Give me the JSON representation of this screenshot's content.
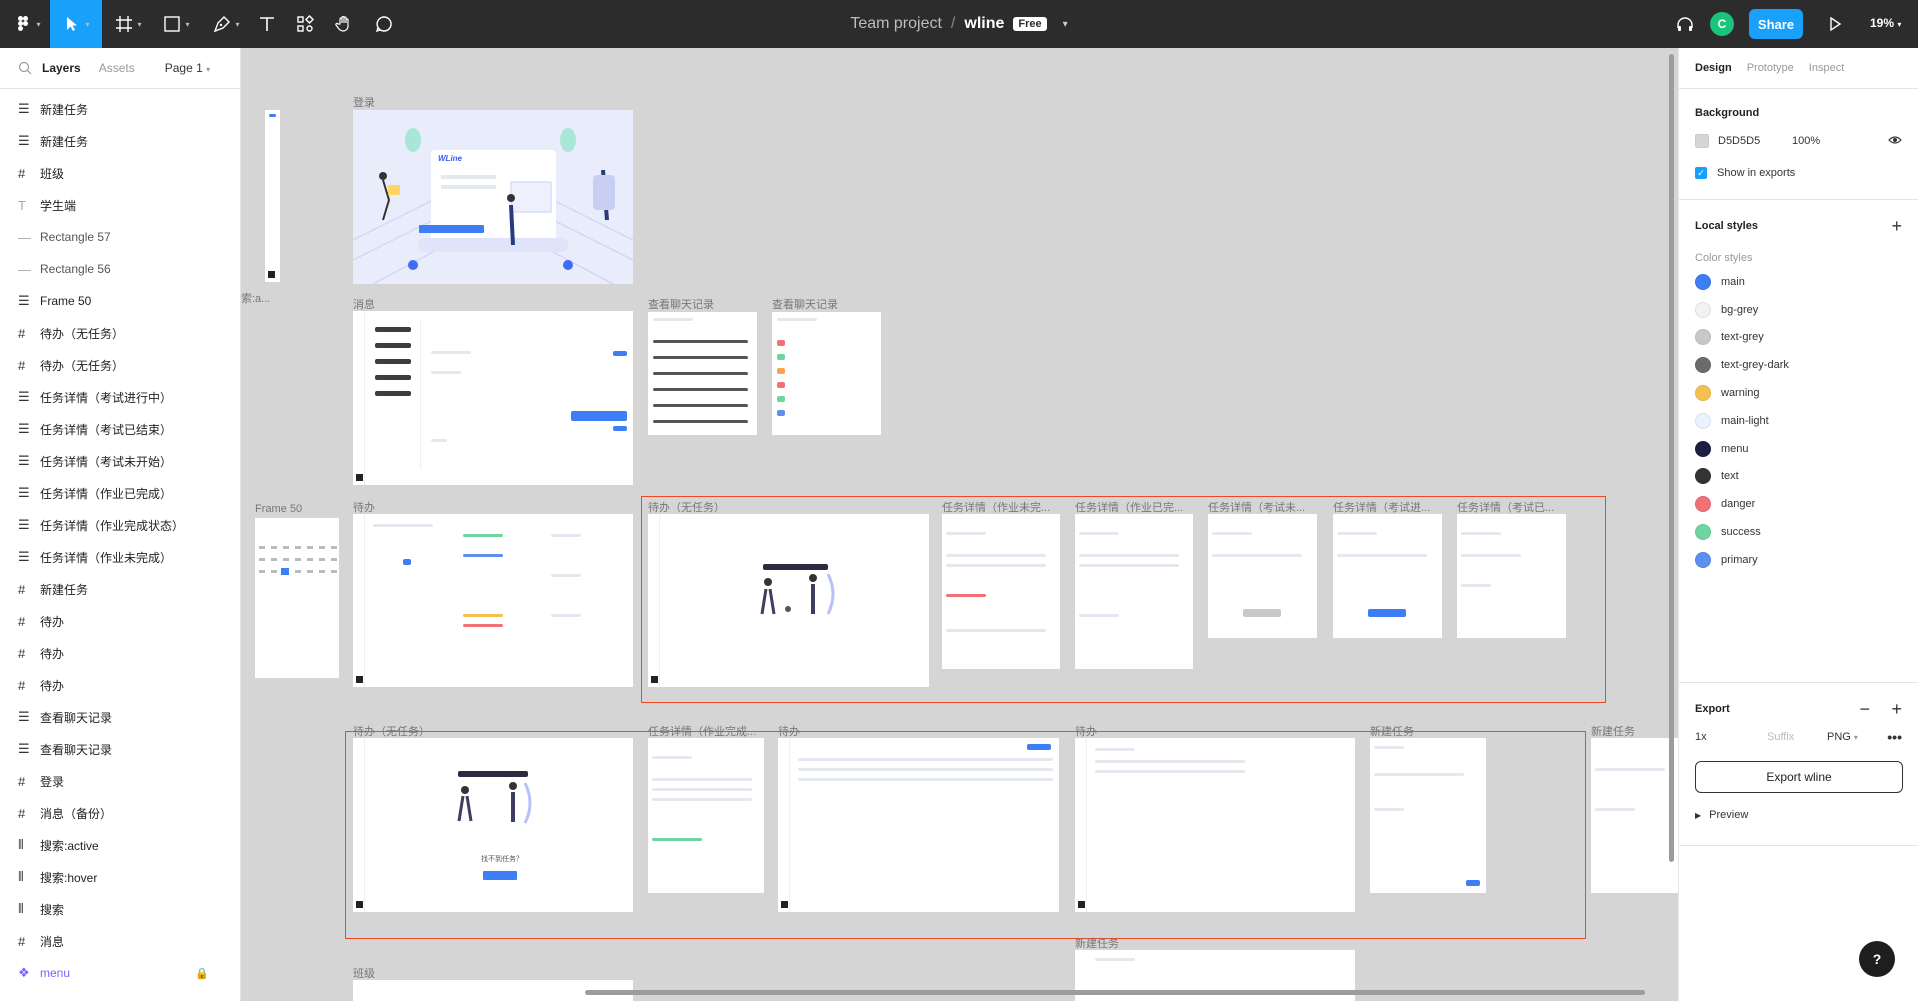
{
  "toolbar": {
    "project": "Team project",
    "separator": "/",
    "file": "wline",
    "plan_badge": "Free",
    "share_label": "Share",
    "avatar_initial": "C",
    "zoom": "19%"
  },
  "left_panel": {
    "tabs": [
      "Layers",
      "Assets"
    ],
    "page": "Page 1",
    "layers": [
      {
        "label": "新建任务",
        "icon": "rows-icon"
      },
      {
        "label": "新建任务",
        "icon": "rows-icon"
      },
      {
        "label": "班级",
        "icon": "frame-icon"
      },
      {
        "label": "学生端",
        "icon": "text-icon"
      },
      {
        "label": "Rectangle 57",
        "icon": "rectangle-icon"
      },
      {
        "label": "Rectangle 56",
        "icon": "rectangle-icon"
      },
      {
        "label": "Frame 50",
        "icon": "rows-icon"
      },
      {
        "label": "待办（无任务）",
        "icon": "frame-icon"
      },
      {
        "label": "待办（无任务）",
        "icon": "frame-icon"
      },
      {
        "label": "任务详情（考试进行中）",
        "icon": "rows-icon"
      },
      {
        "label": "任务详情（考试已结束）",
        "icon": "rows-icon"
      },
      {
        "label": "任务详情（考试未开始）",
        "icon": "rows-icon"
      },
      {
        "label": "任务详情（作业已完成）",
        "icon": "rows-icon"
      },
      {
        "label": "任务详情（作业完成状态）",
        "icon": "rows-icon"
      },
      {
        "label": "任务详情（作业未完成）",
        "icon": "rows-icon"
      },
      {
        "label": "新建任务",
        "icon": "frame-icon"
      },
      {
        "label": "待办",
        "icon": "frame-icon"
      },
      {
        "label": "待办",
        "icon": "frame-icon"
      },
      {
        "label": "待办",
        "icon": "frame-icon"
      },
      {
        "label": "查看聊天记录",
        "icon": "rows-icon"
      },
      {
        "label": "查看聊天记录",
        "icon": "rows-icon"
      },
      {
        "label": "登录",
        "icon": "frame-icon"
      },
      {
        "label": "消息（备份）",
        "icon": "frame-icon"
      },
      {
        "label": "搜索:active",
        "icon": "columns-icon"
      },
      {
        "label": "搜索:hover",
        "icon": "columns-icon"
      },
      {
        "label": "搜索",
        "icon": "columns-icon"
      },
      {
        "label": "消息",
        "icon": "frame-icon"
      },
      {
        "label": "menu",
        "icon": "component-icon"
      }
    ]
  },
  "canvas": {
    "frames": {
      "login": "登录",
      "messages": "消息",
      "chat_1": "查看聊天记录",
      "chat_2": "查看聊天记录",
      "frame50": "Frame 50",
      "todo": "待办",
      "todo_empty": "待办（无任务）",
      "d1": "任务详情（作业未完...",
      "d2": "任务详情（作业已完...",
      "d3": "任务详情（考试未...",
      "d4": "任务详情（考试进...",
      "d5": "任务详情（考试已...",
      "todo_empty_2": "待办（无任务）",
      "d6": "任务详情（作业完成...",
      "todo_2": "待办",
      "todo_3": "待办",
      "new_task": "新建任务",
      "new_task_2": "新建任务",
      "new_task_3": "新建任务",
      "class": "班级",
      "search_cut": "索:a..."
    },
    "login_logo": "WLine",
    "empty_question": "找不到任务？"
  },
  "right_panel": {
    "tabs": [
      "Design",
      "Prototype",
      "Inspect"
    ],
    "background_title": "Background",
    "bg_hex": "D5D5D5",
    "bg_opacity": "100%",
    "show_in_exports": "Show in exports",
    "local_styles_title": "Local styles",
    "color_styles_title": "Color styles",
    "colors": [
      {
        "name": "main",
        "hex": "#3d7df5"
      },
      {
        "name": "bg-grey",
        "hex": "#f2f2f2"
      },
      {
        "name": "text-grey",
        "hex": "#c8c8c8"
      },
      {
        "name": "text-grey-dark",
        "hex": "#6b6b6b"
      },
      {
        "name": "warning",
        "hex": "#f5c04f"
      },
      {
        "name": "main-light",
        "hex": "#eaf2fd"
      },
      {
        "name": "menu",
        "hex": "#1e1e40"
      },
      {
        "name": "text",
        "hex": "#333333"
      },
      {
        "name": "danger",
        "hex": "#f07176"
      },
      {
        "name": "success",
        "hex": "#6fd5a0"
      },
      {
        "name": "primary",
        "hex": "#5b8ff0"
      }
    ],
    "export_title": "Export",
    "export_scale": "1x",
    "export_suffix": "Suffix",
    "export_format": "PNG",
    "export_button": "Export wline",
    "preview_label": "Preview"
  },
  "help_label": "?"
}
